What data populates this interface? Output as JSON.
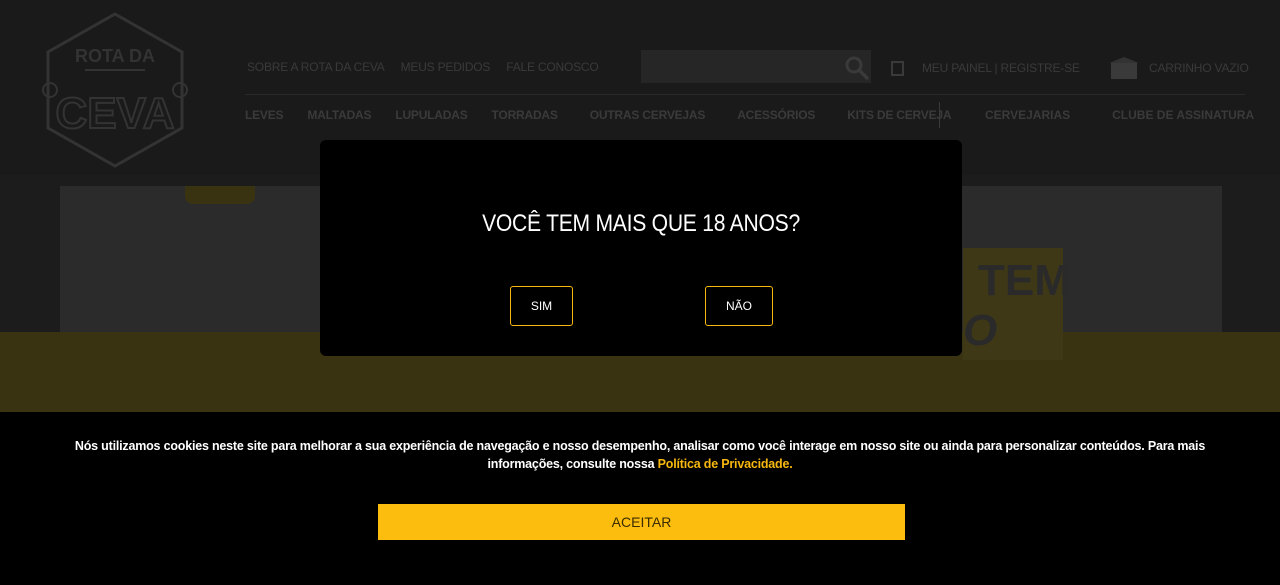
{
  "header": {
    "logo_top": "ROTA DA",
    "logo_bottom": "CEVA",
    "top_links": [
      "SOBRE A ROTA DA CEVA",
      "MEUS PEDIDOS",
      "FALE CONOSCO"
    ],
    "account_label": "MEU PAINEL | REGISTRE-SE",
    "cart_label": "CARRINHO VAZIO",
    "categories": [
      "LEVES",
      "MALTADAS",
      "LUPULADAS",
      "TORRADAS",
      "OUTRAS CERVEJAS",
      "ACESSÓRIOS",
      "KITS DE CERVEJA"
    ],
    "categories_right": [
      "CERVEJARIAS",
      "CLUBE DE ASSINATURA"
    ]
  },
  "banner": {
    "word1": "TEM",
    "word2": "O"
  },
  "age_gate": {
    "title": "VOCÊ TEM MAIS QUE 18 ANOS?",
    "yes_label": "SIM",
    "no_label": "NÃO",
    "accent_color": "#f6b70f"
  },
  "cookie": {
    "message": "Nós utilizamos cookies neste site para melhorar a sua experiência de navegação e nosso desempenho, analisar como você interage em nosso site ou ainda para personalizar conteúdos. Para mais informações, consulte nossa ",
    "link_text": "Política de Privacidade.",
    "accept_label": "ACEITAR",
    "accept_color": "#fdbd0e"
  },
  "icons": {
    "search": "search-icon",
    "account": "user-icon",
    "cart": "cart-icon"
  }
}
